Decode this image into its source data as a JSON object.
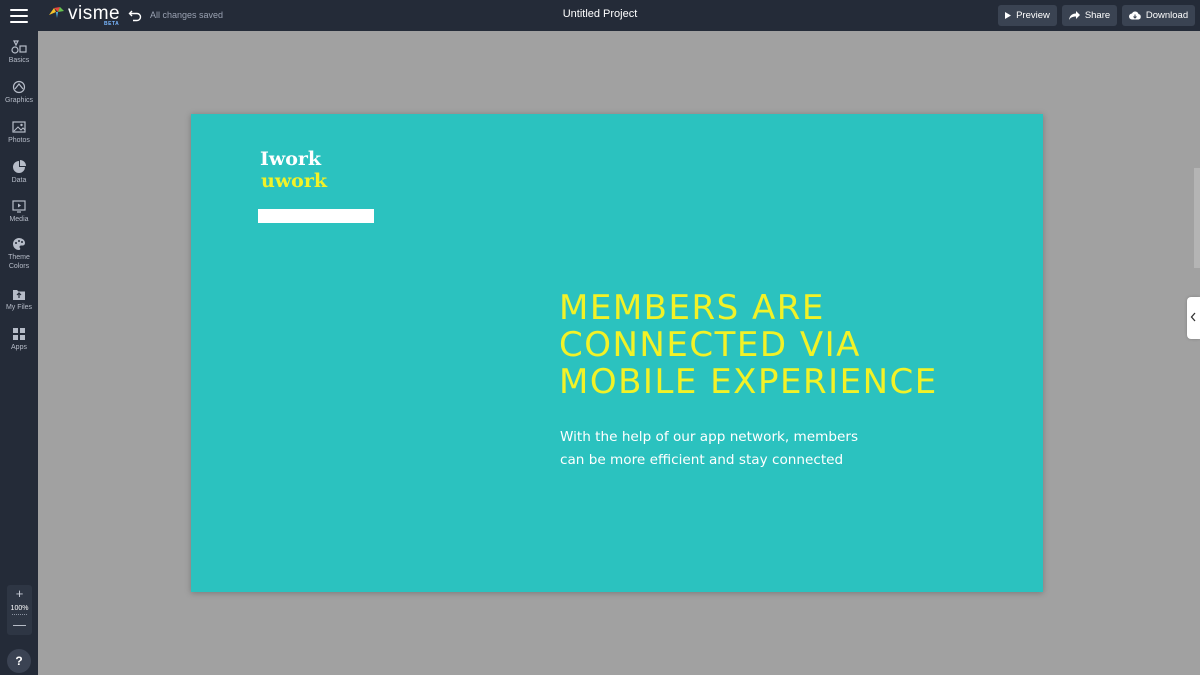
{
  "app": {
    "logo_text": "visme",
    "logo_badge": "BETA",
    "save_status": "All changes saved",
    "project_title": "Untitled Project"
  },
  "toolbar": {
    "preview_label": "Preview",
    "share_label": "Share",
    "download_label": "Download"
  },
  "sidebar": {
    "items": [
      {
        "label": "Basics",
        "icon": "basics-icon"
      },
      {
        "label": "Graphics",
        "icon": "graphics-icon"
      },
      {
        "label": "Photos",
        "icon": "photos-icon"
      },
      {
        "label": "Data",
        "icon": "data-icon"
      },
      {
        "label": "Media",
        "icon": "media-icon"
      },
      {
        "label_line1": "Theme",
        "label_line2": "Colors",
        "icon": "palette-icon"
      },
      {
        "label": "My Files",
        "icon": "my-files-icon"
      },
      {
        "label": "Apps",
        "icon": "apps-icon"
      }
    ],
    "zoom": {
      "plus": "+",
      "level": "100%",
      "minus": "—"
    },
    "help": "?"
  },
  "slide": {
    "brand_line1": "Iwork",
    "brand_line2": "uwork",
    "headline": [
      "MEMBERS ARE",
      "CONNECTED VIA",
      "MOBILE EXPERIENCE"
    ],
    "subtext_line1": "With the help of our app network, members",
    "subtext_line2": "can be more efficient and stay connected",
    "colors": {
      "background": "#2bc2bf",
      "accent": "#f2f227",
      "text": "#ffffff"
    }
  },
  "colors": {
    "topbar": "#242b38",
    "canvas_bg": "#a1a1a1",
    "button_bg": "#3a4352"
  }
}
